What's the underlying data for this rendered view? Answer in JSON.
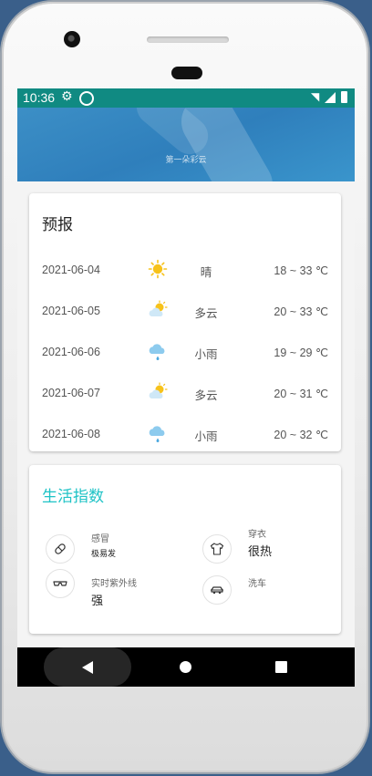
{
  "status_bar": {
    "time": "10:36",
    "icons": [
      "settings-icon",
      "sync-icon",
      "wifi-icon",
      "signal-icon",
      "battery-icon"
    ]
  },
  "header": {
    "sky_text": "第一朵彩云"
  },
  "forecast": {
    "title": "预报",
    "rows": [
      {
        "date": "2021-06-04",
        "sky": "晴",
        "icon": "sunny-icon",
        "temp": "18 ~ 33 ℃"
      },
      {
        "date": "2021-06-05",
        "sky": "多云",
        "icon": "partly-cloudy-icon",
        "temp": "20 ~ 33 ℃"
      },
      {
        "date": "2021-06-06",
        "sky": "小雨",
        "icon": "light-rain-icon",
        "temp": "19 ~ 29 ℃"
      },
      {
        "date": "2021-06-07",
        "sky": "多云",
        "icon": "partly-cloudy-icon",
        "temp": "20 ~ 31 ℃"
      },
      {
        "date": "2021-06-08",
        "sky": "小雨",
        "icon": "light-rain-icon",
        "temp": "20 ~ 32 ℃"
      }
    ]
  },
  "life_index": {
    "title": "生活指数",
    "items": [
      {
        "name": "感冒",
        "value": "极易发",
        "icon": "pill-icon"
      },
      {
        "name": "穿衣",
        "value": "很热",
        "icon": "shirt-icon"
      },
      {
        "name": "实时紫外线",
        "value": "强",
        "icon": "sunglasses-icon"
      },
      {
        "name": "洗车",
        "value": "",
        "icon": "car-icon"
      }
    ],
    "accent_color": "#1fc3c6"
  },
  "nav_bar": {
    "buttons": [
      "back-icon",
      "home-icon",
      "recents-icon"
    ]
  }
}
